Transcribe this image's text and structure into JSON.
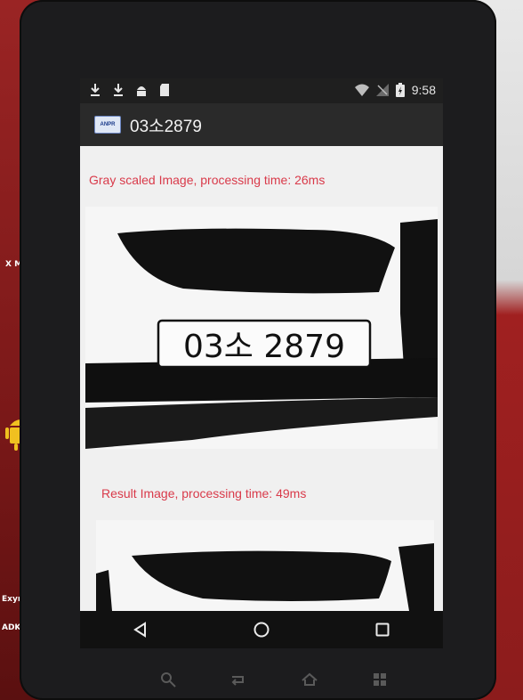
{
  "statusbar": {
    "left_icons": [
      "download-icon",
      "download-icon",
      "android-debug-icon",
      "sd-card-icon"
    ],
    "right_icons": [
      "wifi-icon",
      "no-signal-icon",
      "battery-charging-icon"
    ],
    "time": "9:58"
  },
  "appbar": {
    "title": "03소2879"
  },
  "content": {
    "gray_caption": "Gray scaled Image, processing time: 26ms",
    "plate_text": "03소 2879",
    "result_caption": "Result Image, processing time: 49ms"
  },
  "navbar": {
    "buttons": [
      "back-icon",
      "home-icon",
      "recents-icon"
    ]
  },
  "bezel": {
    "keys": [
      "search-icon",
      "return-icon",
      "home-key-icon",
      "menu-icon"
    ]
  },
  "board": {
    "labels": [
      "X MS",
      "Exynos",
      "ADK/RSP"
    ]
  },
  "colors": {
    "caption": "#d93a4a",
    "appbar": "#2a2a2a",
    "statusbar": "#1f1f1f"
  }
}
